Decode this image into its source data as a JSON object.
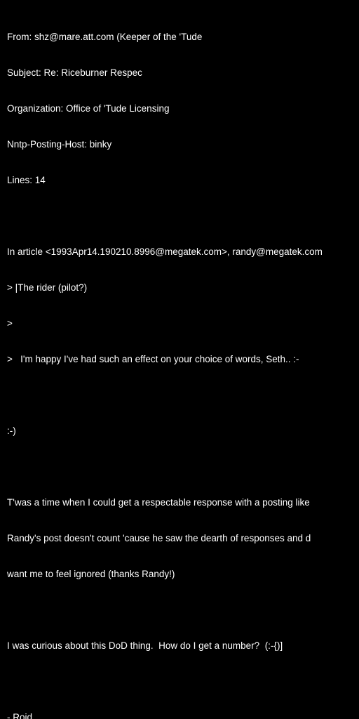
{
  "header": {
    "from": "From: shz@mare.att.com (Keeper of the 'Tude",
    "subject": "Subject: Re: Riceburner Respec",
    "organization": "Organization: Office of 'Tude Licensing",
    "nntp_posting_host": "Nntp-Posting-Host: binky",
    "lines": "Lines: 14"
  },
  "body": {
    "attribution": "In article <1993Apr14.190210.8996@megatek.com>, randy@megatek.com",
    "quote_1": "> |The rider (pilot?)",
    "quote_2": ">",
    "quote_3": ">   I'm happy I've had such an effect on your choice of words, Seth.. :-",
    "smiley": ":-)",
    "para_1_line_1": "T'was a time when I could get a respectable response with a posting like",
    "para_1_line_2": "Randy's post doesn't count 'cause he saw the dearth of responses and d",
    "para_1_line_3": "want me to feel ignored (thanks Randy!)",
    "para_2": "I was curious about this DoD thing.  How do I get a number?  (:-{)]",
    "signature": "- Roid"
  },
  "colors": {
    "background": "#000000",
    "text": "#ffffff"
  }
}
